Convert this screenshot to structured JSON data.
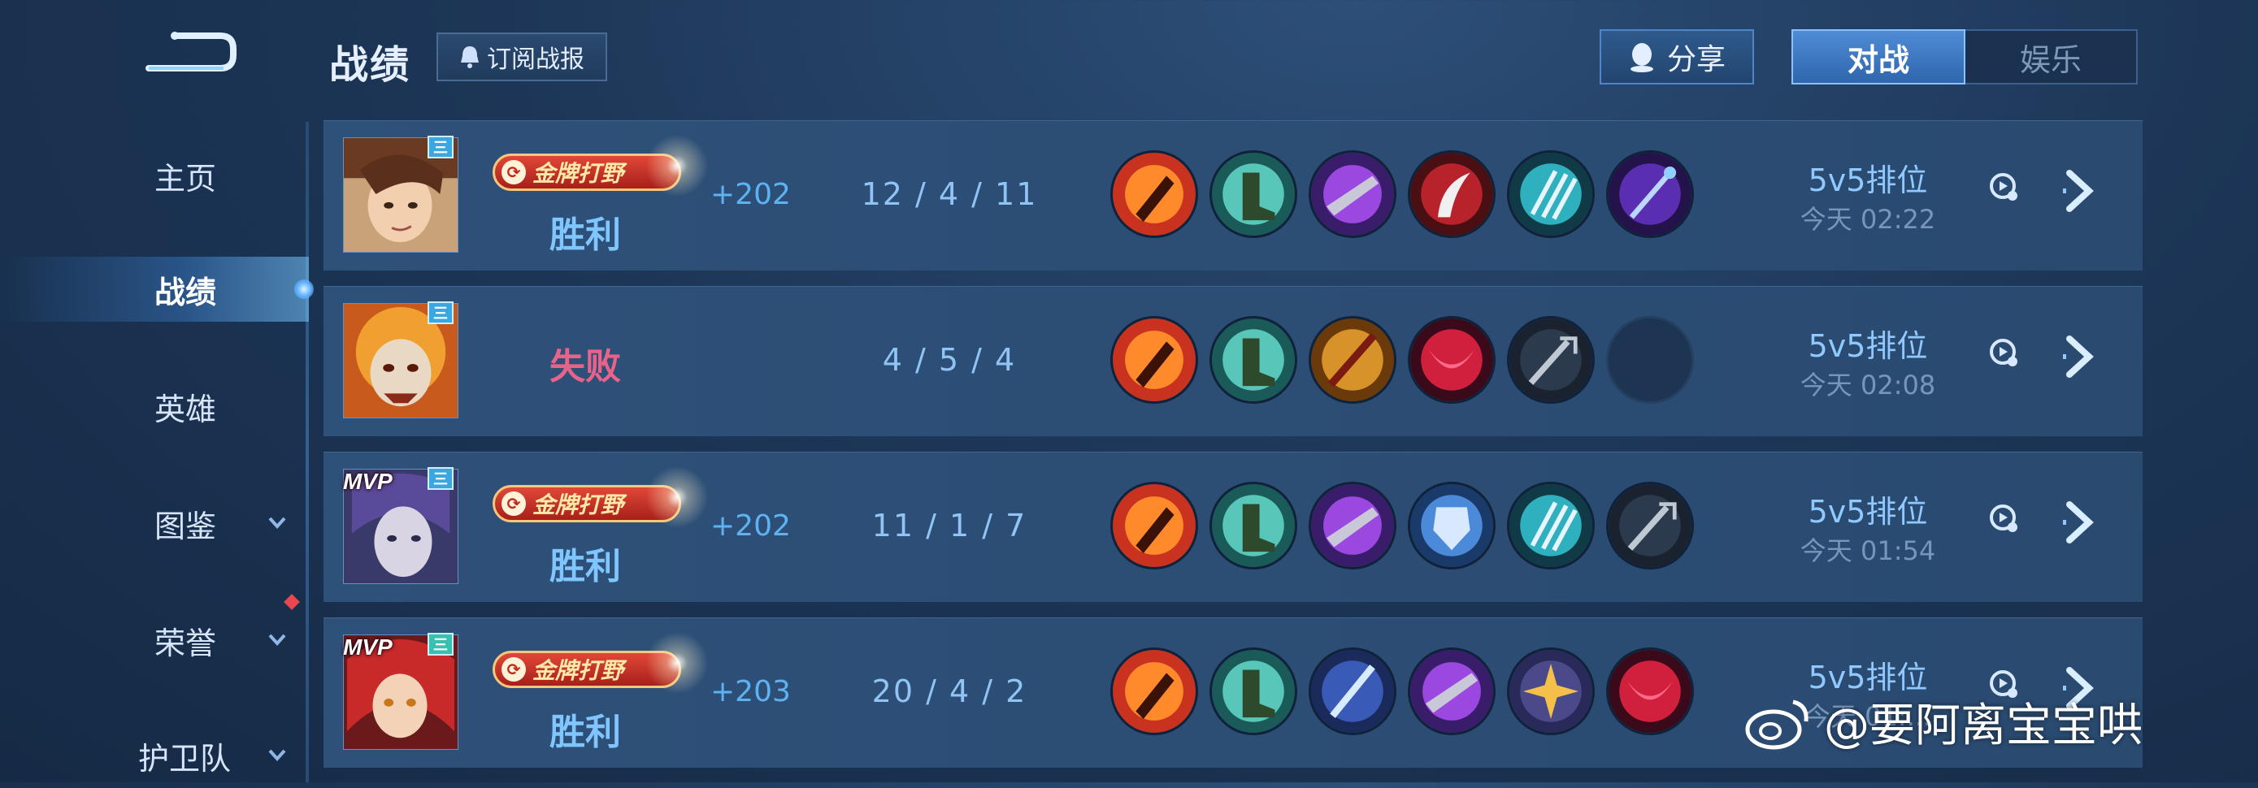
{
  "header": {
    "title": "战绩",
    "subscribe_label": "订阅战报",
    "share_label": "分享",
    "mode_tabs": [
      {
        "label": "对战",
        "active": true
      },
      {
        "label": "娱乐",
        "active": false
      }
    ]
  },
  "sidebar": {
    "items": [
      {
        "label": "主页",
        "active": false,
        "has_chevron": false
      },
      {
        "label": "战绩",
        "active": true,
        "has_chevron": false
      },
      {
        "label": "英雄",
        "active": false,
        "has_chevron": false
      },
      {
        "label": "图鉴",
        "active": false,
        "has_chevron": true
      },
      {
        "label": "荣誉",
        "active": false,
        "has_chevron": true,
        "red_dot": true
      },
      {
        "label": "护卫队",
        "active": false,
        "has_chevron": true
      }
    ]
  },
  "matches": [
    {
      "hero": "hero-1",
      "rank_badge": "三",
      "mvp": "",
      "gold_badge": "金牌打野",
      "result": "胜利",
      "points": "+202",
      "kda": "12 / 4 / 11",
      "mode": "5v5排位",
      "time": "今天 02:22",
      "items": [
        "red-axe",
        "green-boots",
        "purple-blade",
        "red-sickle",
        "cyan-claw",
        "violet-staff"
      ]
    },
    {
      "hero": "hero-2",
      "rank_badge": "三",
      "mvp": "",
      "gold_badge": "",
      "result": "失败",
      "points": "",
      "kda": "4 / 5 / 4",
      "mode": "5v5排位",
      "time": "今天 02:08",
      "items": [
        "red-axe",
        "green-boots",
        "gold-spear",
        "red-mask",
        "dark-trident",
        "empty"
      ]
    },
    {
      "hero": "hero-3",
      "rank_badge": "三",
      "mvp": "MVP",
      "gold_badge": "金牌打野",
      "result": "胜利",
      "points": "+202",
      "kda": "11 / 1 / 7",
      "mode": "5v5排位",
      "time": "今天 01:54",
      "items": [
        "red-axe",
        "green-boots",
        "purple-blade",
        "blue-shield",
        "cyan-claw",
        "dark-trident"
      ]
    },
    {
      "hero": "hero-4",
      "rank_badge": "三",
      "mvp": "MVP",
      "gold_badge": "金牌打野",
      "result": "胜利",
      "points": "+203",
      "kda": "20 / 4 / 2",
      "mode": "5v5排位",
      "time": "今天 01:...",
      "items": [
        "red-axe",
        "green-boots",
        "blue-sword",
        "purple-blade",
        "gold-star",
        "red-mask"
      ]
    }
  ],
  "watermark": "@要阿离宝宝哄",
  "colors": {
    "win": "#7fc6ff",
    "loss": "#e8628a",
    "accent": "#4f8cd6"
  },
  "icons": [
    "back-icon",
    "subscribe-icon",
    "share-icon",
    "replay-icon",
    "chevron-right-icon",
    "chevron-down-icon",
    "weibo-icon"
  ]
}
